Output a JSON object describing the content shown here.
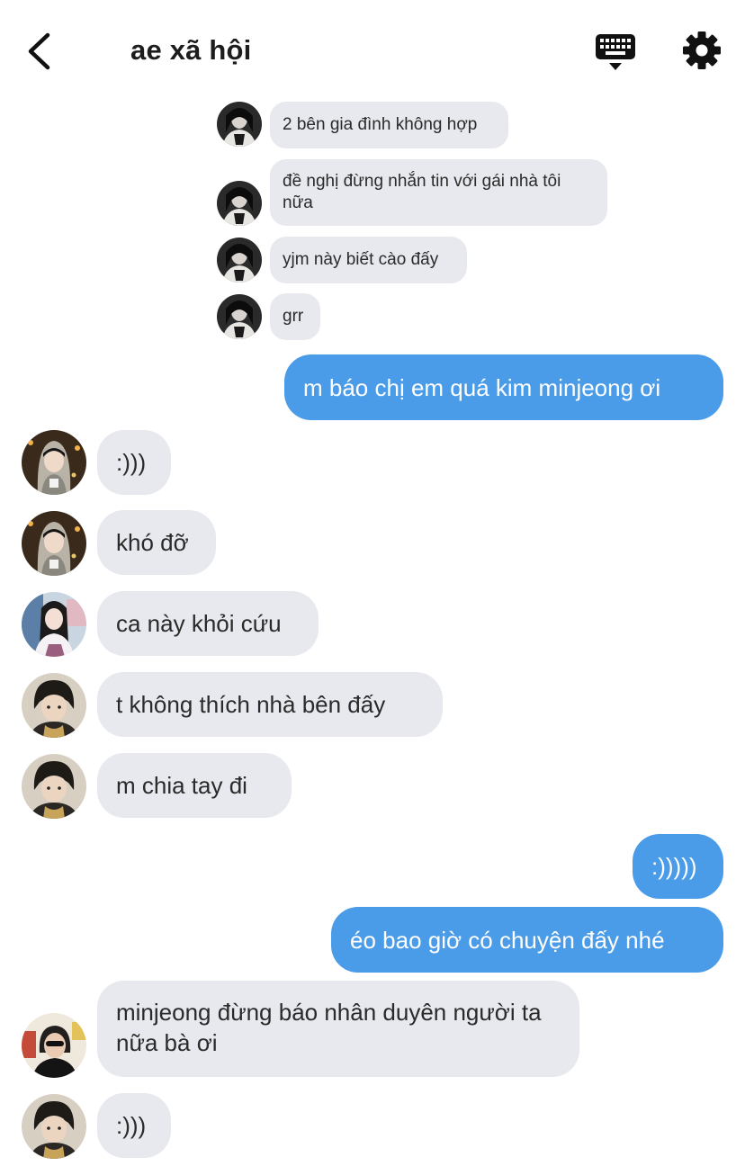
{
  "header": {
    "title": "ae xã hội",
    "back_icon": "chevron-left-icon",
    "keyboard_icon": "keyboard-icon",
    "settings_icon": "gear-icon"
  },
  "colors": {
    "incoming_bubble": "#e7e9ee",
    "outgoing_bubble": "#4a9ce8",
    "outgoing_text": "#ffffff",
    "incoming_text": "#2a2a2a"
  },
  "messages": [
    {
      "sender": "other",
      "text": "2 bên gia đình không hợp"
    },
    {
      "sender": "other",
      "text": "đề nghị đừng nhắn tin với gái nhà tôi nữa"
    },
    {
      "sender": "other",
      "text": "yjm này biết cào đấy"
    },
    {
      "sender": "other",
      "text": "grr"
    },
    {
      "sender": "me",
      "text": "m báo chị em quá kim minjeong ơi"
    },
    {
      "sender": "other",
      "text": ":)))"
    },
    {
      "sender": "other",
      "text": "khó đỡ"
    },
    {
      "sender": "other",
      "text": "ca này khỏi cứu"
    },
    {
      "sender": "other",
      "text": "t không thích nhà bên đấy"
    },
    {
      "sender": "other",
      "text": "m chia tay đi"
    },
    {
      "sender": "me",
      "text": ":)))))"
    },
    {
      "sender": "me",
      "text": "éo bao giờ có chuyện đấy nhé"
    },
    {
      "sender": "other",
      "text": "minjeong đừng báo nhân duyên người ta nữa bà ơi"
    },
    {
      "sender": "other",
      "text": ":)))"
    }
  ]
}
